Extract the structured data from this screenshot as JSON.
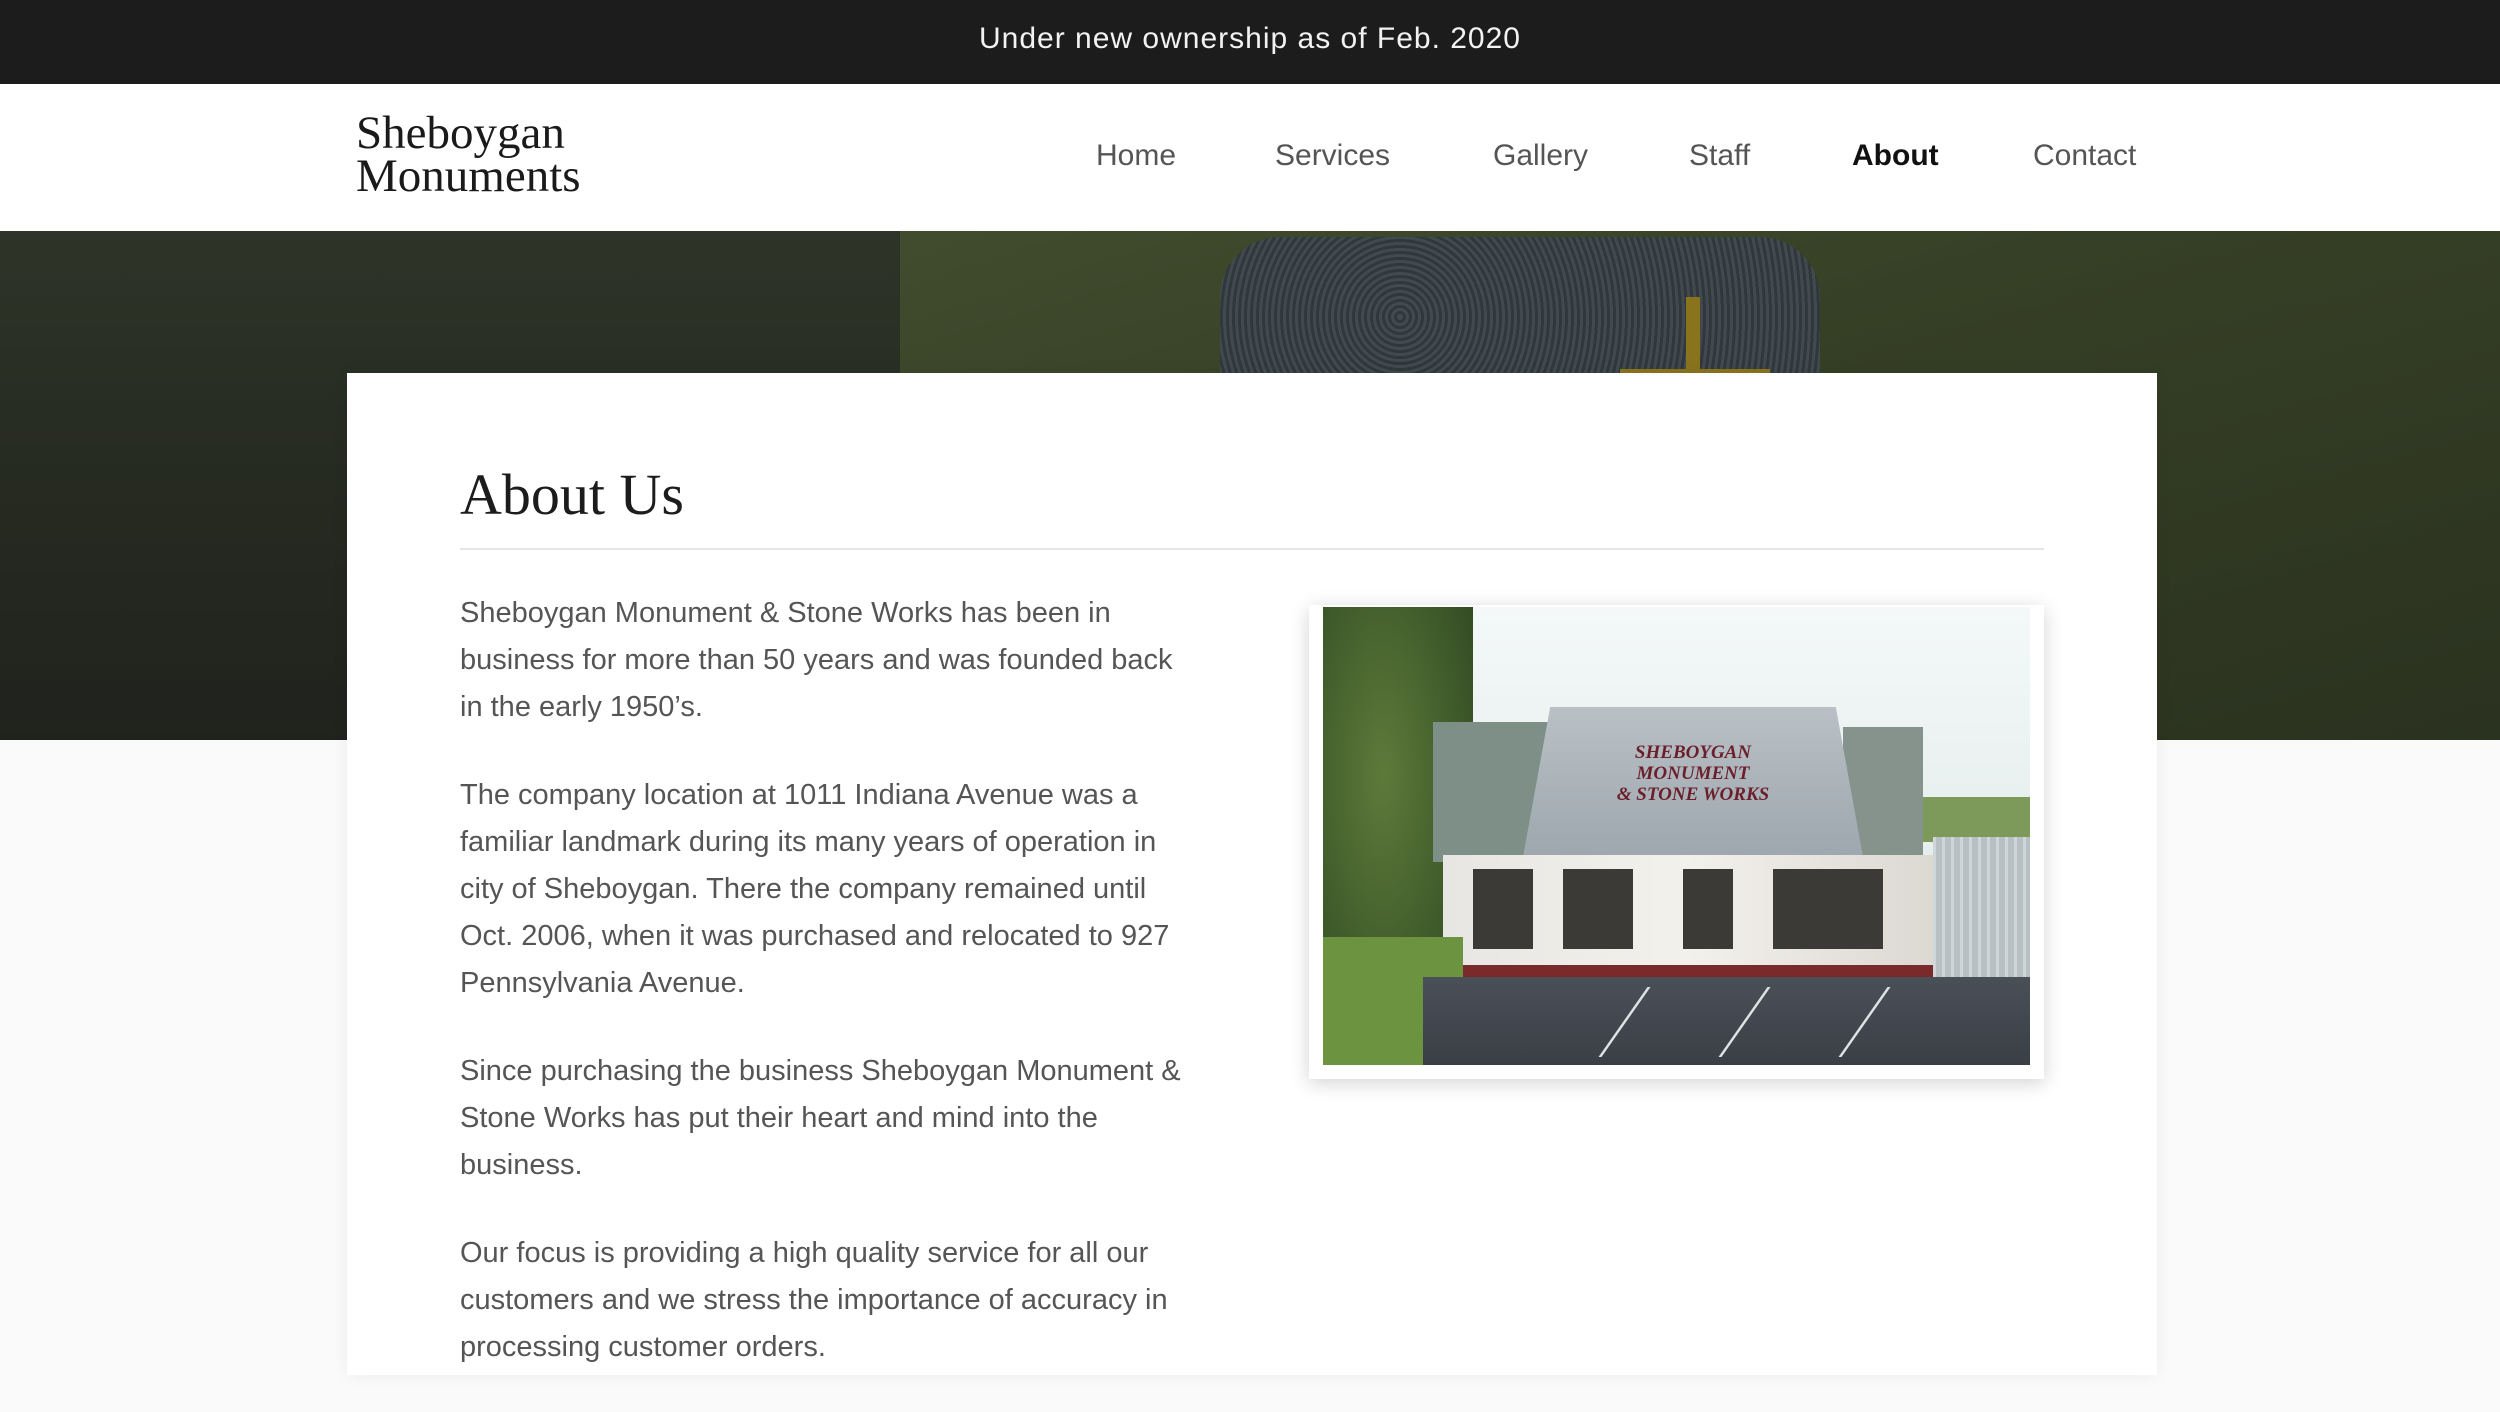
{
  "announcement": "Under new ownership as of Feb. 2020",
  "brand": {
    "line1": "Sheboygan",
    "line2": "Monuments"
  },
  "nav": {
    "items": [
      "Home",
      "Services",
      "Gallery",
      "Staff",
      "About",
      "Contact"
    ],
    "active": "About"
  },
  "page": {
    "title": "About Us",
    "paragraphs": [
      "Sheboygan Monument & Stone Works has been in business for more than 50 years and was founded back in the early 1950’s.",
      "The company location at 1011 Indiana Avenue was a familiar landmark during its many years of operation in city of Sheboygan. There the company remained until Oct. 2006, when it was purchased and relocated to 927 Pennsylvania Avenue.",
      "Since purchasing the business Sheboygan Monument & Stone Works has put their heart and mind into the business.",
      "Our focus is providing a high quality service for all our customers and we stress the importance of accuracy in processing customer orders."
    ]
  },
  "photo": {
    "sign_lines": [
      "SHEBOYGAN",
      "MONUMENT",
      "& STONE WORKS"
    ]
  },
  "colors": {
    "topbar": "#1c1c1c",
    "nav_text": "#555555",
    "nav_active": "#111111",
    "body_text": "#555555",
    "page_background": "#fafafa"
  }
}
